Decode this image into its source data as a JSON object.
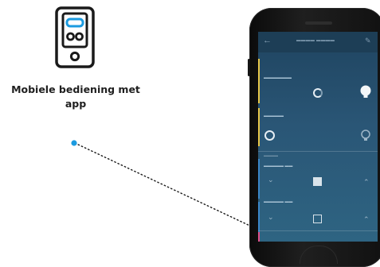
{
  "caption": {
    "line1": "Mobiele bediening met",
    "line2": "app"
  },
  "icons": {
    "app": "smartphone-icon",
    "back": "arrow-left-icon",
    "edit": "pencil-icon",
    "bulb": "light-bulb-icon"
  },
  "colors": {
    "brand": "#1b9be0",
    "screen_bg": "#2a5676",
    "accent_yellow": "#e8c84a",
    "accent_pink": "#e0508a"
  },
  "screen": {
    "back_glyph": "←",
    "edit_glyph": "✎",
    "rows": [
      {
        "accent": "#e8c84a"
      },
      {
        "accent": "#e8c84a"
      },
      {
        "accent": "#3a86c8"
      },
      {
        "accent": "#3a86c8"
      }
    ],
    "blind_controls": {
      "down": "⌄",
      "up": "⌃"
    }
  }
}
